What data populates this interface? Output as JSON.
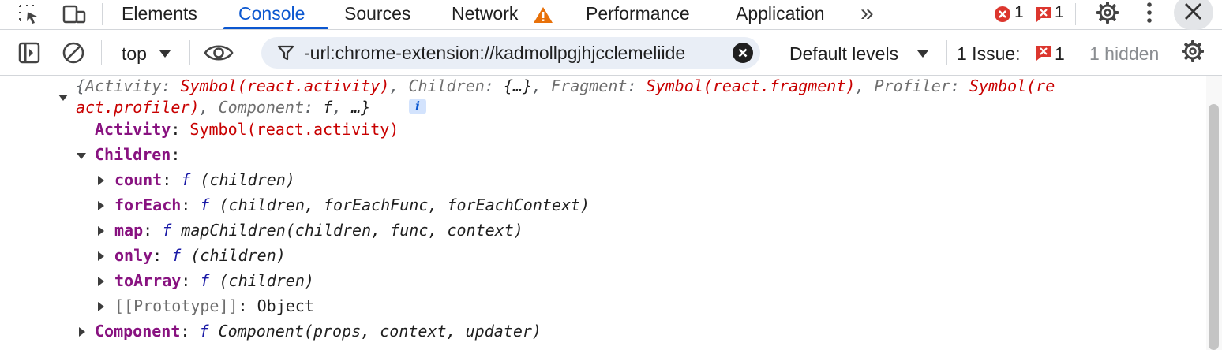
{
  "tabbar": {
    "tabs": [
      {
        "label": "Elements"
      },
      {
        "label": "Console"
      },
      {
        "label": "Sources"
      },
      {
        "label": "Network"
      },
      {
        "label": "Performance"
      },
      {
        "label": "Application"
      }
    ],
    "active_tab": "Console",
    "more_tabs_glyph": "»",
    "error_count": "1",
    "issue_count": "1",
    "icons": [
      "inspect-element-icon",
      "device-toolbar-icon",
      "warning-icon",
      "overflow-chevron-icon",
      "error-circle-icon",
      "issue-flag-icon",
      "settings-gear-icon",
      "more-vertical-icon",
      "close-icon"
    ]
  },
  "toolbar": {
    "context": "top",
    "filter_value": "-url:chrome-extension://kadmollpgjhjcclemeliide",
    "levels": "Default levels",
    "issues_label": "1 Issue:",
    "issues_count": "1",
    "hidden_label": "1 hidden",
    "icons": [
      "sidebar-toggle-icon",
      "clear-console-icon",
      "dropdown-caret-icon",
      "live-expression-eye-icon",
      "filter-funnel-icon",
      "clear-filter-icon",
      "issue-flag-icon",
      "console-settings-gear-icon"
    ]
  },
  "console": {
    "summary": {
      "open": "{",
      "activity_key": "Activity",
      "activity_val": "Symbol(react.activity)",
      "children_key": "Children",
      "children_val": "{…}",
      "fragment_key": "Fragment",
      "fragment_val": "Symbol(react.fragment)",
      "profiler_key": "Profiler",
      "profiler_val_1": "Symbol(re",
      "profiler_val_2": "act.profiler)",
      "component_key": "Component",
      "component_val": "f",
      "ellipsis": "…}",
      "info": "i"
    },
    "entries": [
      {
        "key": "Activity",
        "value": "Symbol(react.activity)"
      },
      {
        "key": "Children",
        "value": ""
      },
      {
        "key": "count",
        "fn": "f",
        "sig": "(children)"
      },
      {
        "key": "forEach",
        "fn": "f",
        "sig": "(children, forEachFunc, forEachContext)"
      },
      {
        "key": "map",
        "fn": "f",
        "sig": "mapChildren(children, func, context)"
      },
      {
        "key": "only",
        "fn": "f",
        "sig": "(children)"
      },
      {
        "key": "toArray",
        "fn": "f",
        "sig": "(children)"
      },
      {
        "key": "[[Prototype]]",
        "value": "Object"
      },
      {
        "key": "Component",
        "fn": "f",
        "sig": "Component(props, context, updater)"
      }
    ],
    "colon": ":"
  },
  "colors": {
    "accent": "#0b57d0",
    "error": "#dc362e",
    "key_purple": "#881280",
    "string_red": "#c80000",
    "function_blue": "#1a1aa6"
  }
}
